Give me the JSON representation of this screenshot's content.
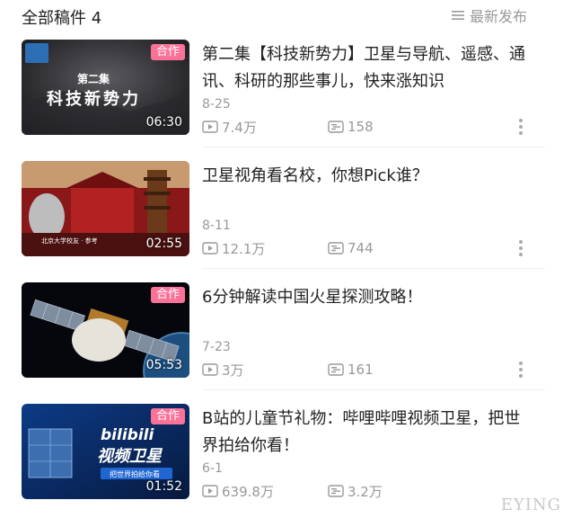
{
  "header": {
    "title": "全部稿件 4",
    "sort_label": "最新发布",
    "sort_icon": "list-icon"
  },
  "videos": [
    {
      "title": "第二集【科技新势力】卫星与导航、遥感、通讯、科研的那些事儿，快来涨知识",
      "date": "8-25",
      "views": "7.4万",
      "danmaku": "158",
      "duration": "06:30",
      "badge": "合作",
      "thumb_text_1": "第二集",
      "thumb_text_2": "科技新势力"
    },
    {
      "title": "卫星视角看名校，你想Pick谁？",
      "date": "8-11",
      "views": "12.1万",
      "danmaku": "744",
      "duration": "02:55",
      "badge": "",
      "thumb_text_1": "北京大学校友 · 参考"
    },
    {
      "title": "6分钟解读中国火星探测攻略！",
      "date": "7-23",
      "views": "3万",
      "danmaku": "161",
      "duration": "05:53",
      "badge": "合作"
    },
    {
      "title": "B站的儿童节礼物：哔哩哔哩视频卫星，把世界拍给你看！",
      "date": "6-1",
      "views": "639.8万",
      "danmaku": "3.2万",
      "duration": "01:52",
      "badge": "合作",
      "thumb_text_1": "bilibili",
      "thumb_text_2": "视频卫星",
      "thumb_text_3": "把世界拍给你看"
    }
  ],
  "watermark": "EYING",
  "colors": {
    "badge_pink": "#fb7299",
    "meta_gray": "#999999",
    "title_dark": "#222222"
  }
}
